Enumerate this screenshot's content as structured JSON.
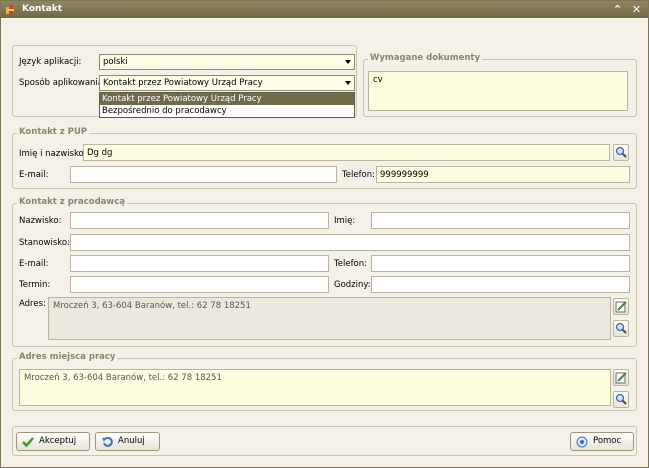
{
  "window": {
    "title": "Kontakt",
    "minimize_glyph": "⌃",
    "close_glyph": "✕"
  },
  "app": {
    "language_label": "Język aplikacji:",
    "language_value": "polski",
    "method_label": "Sposób aplikowania:",
    "method_value": "Kontakt przez Powiatowy Urząd Pracy",
    "method_options": [
      "Kontakt przez Powiatowy Urząd Pracy",
      "Bezpośrednio do pracodawcy"
    ]
  },
  "documents": {
    "legend": "Wymagane dokumenty",
    "value": "cv"
  },
  "pup": {
    "legend": "Kontakt z PUP",
    "name_label": "Imię i nazwisko:",
    "name_value": "Dg dg",
    "email_label": "E-mail:",
    "email_value": "",
    "phone_label": "Telefon:",
    "phone_value": "999999999"
  },
  "employer": {
    "legend": "Kontakt z pracodawcą",
    "surname_label": "Nazwisko:",
    "firstname_label": "Imię:",
    "position_label": "Stanowisko:",
    "email_label": "E-mail:",
    "phone_label": "Telefon:",
    "term_label": "Termin:",
    "hours_label": "Godziny:",
    "address_label": "Adres:",
    "address_value": "Mroczeń 3, 63-604 Baranów, tel.: 62 78 18251"
  },
  "workplace": {
    "legend": "Adres miejsca pracy",
    "value": "Mroczeń 3, 63-604 Baranów, tel.: 62 78 18251"
  },
  "buttons": {
    "accept": "Akceptuj",
    "cancel": "Anuluj",
    "help": "Pomoc"
  },
  "icons": {
    "app": "app-icon",
    "search": "magnifier-icon",
    "edit": "edit-icon",
    "accept": "checkmark-icon",
    "cancel": "undo-icon",
    "help": "help-icon"
  },
  "colors": {
    "title_bar": "#7c7459",
    "selected_option": "#6f6a48",
    "required_field": "#fdfde0",
    "accept_icon": "#2f9a2f",
    "cancel_icon": "#3d6fc4"
  }
}
